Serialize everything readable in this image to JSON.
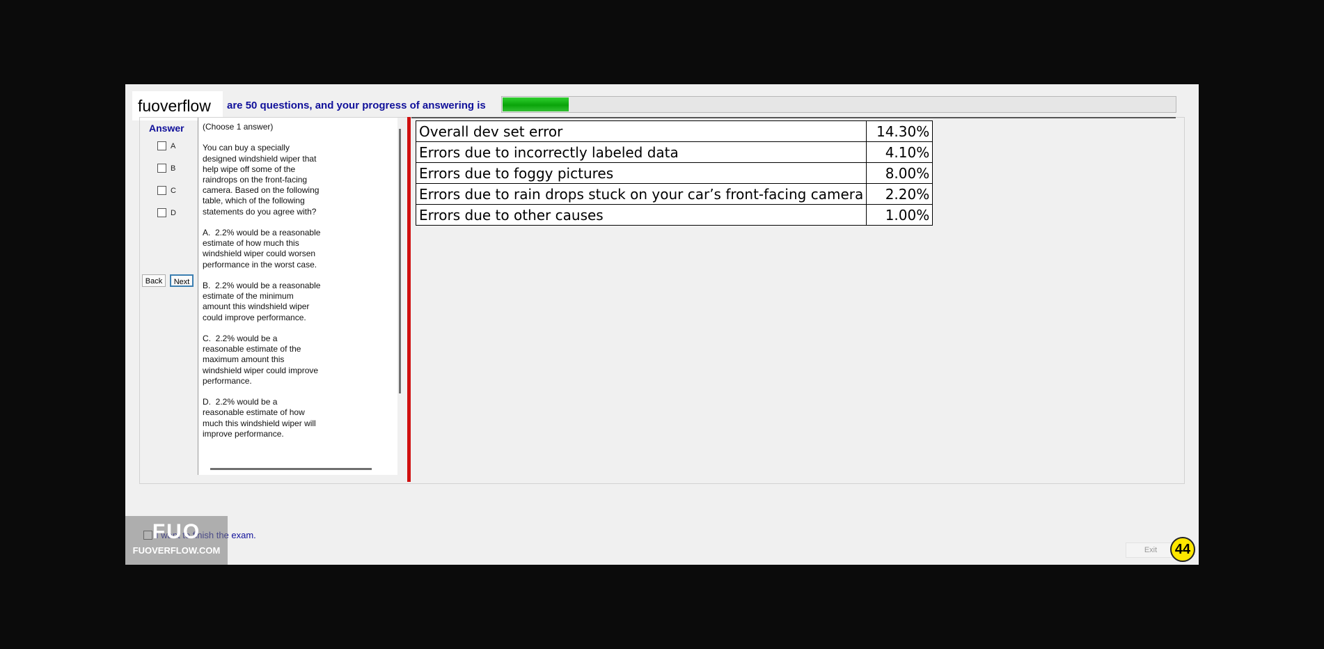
{
  "header": {
    "progress_text": "are 50 questions, and your progress of answering is",
    "progress_fraction": 0.098,
    "progress_color": "#1fbf1f",
    "logo_text": "fuoverflow"
  },
  "answer": {
    "title": "Answer",
    "options": [
      "A",
      "B",
      "C",
      "D"
    ],
    "back_label": "Back",
    "next_label": "Next"
  },
  "question": {
    "text": "(Choose 1 answer)\n\nYou can buy a specially designed windshield wiper that help wipe off some of the raindrops on the front-facing camera. Based on the following table, which of the following statements do you agree with?\n\nA.  2.2% would be a reasonable estimate of how much this windshield wiper could worsen performance in the worst case.\n\nB.  2.2% would be a reasonable estimate of the minimum amount this windshield wiper could improve performance.\n\nC.  2.2% would be a reasonable estimate of the maximum amount this windshield wiper could improve performance.\n\nD.  2.2% would be a reasonable estimate of how much this windshield wiper will improve performance."
  },
  "error_table": {
    "rows": [
      {
        "label": "Overall dev set error",
        "value": "14.30%"
      },
      {
        "label": "Errors due to incorrectly labeled data",
        "value": "4.10%"
      },
      {
        "label": "Errors due to foggy pictures",
        "value": "8.00%"
      },
      {
        "label": "Errors due to rain drops stuck on your car’s front-facing camera",
        "value": "2.20%"
      },
      {
        "label": "Errors due to other causes",
        "value": "1.00%"
      }
    ]
  },
  "footer": {
    "finish_text": "I want to finish the exam.",
    "watermark_big": "FUO",
    "watermark_small": "FUOVERFLOW.COM",
    "exit_label": "Exit",
    "badge_number": "44"
  }
}
